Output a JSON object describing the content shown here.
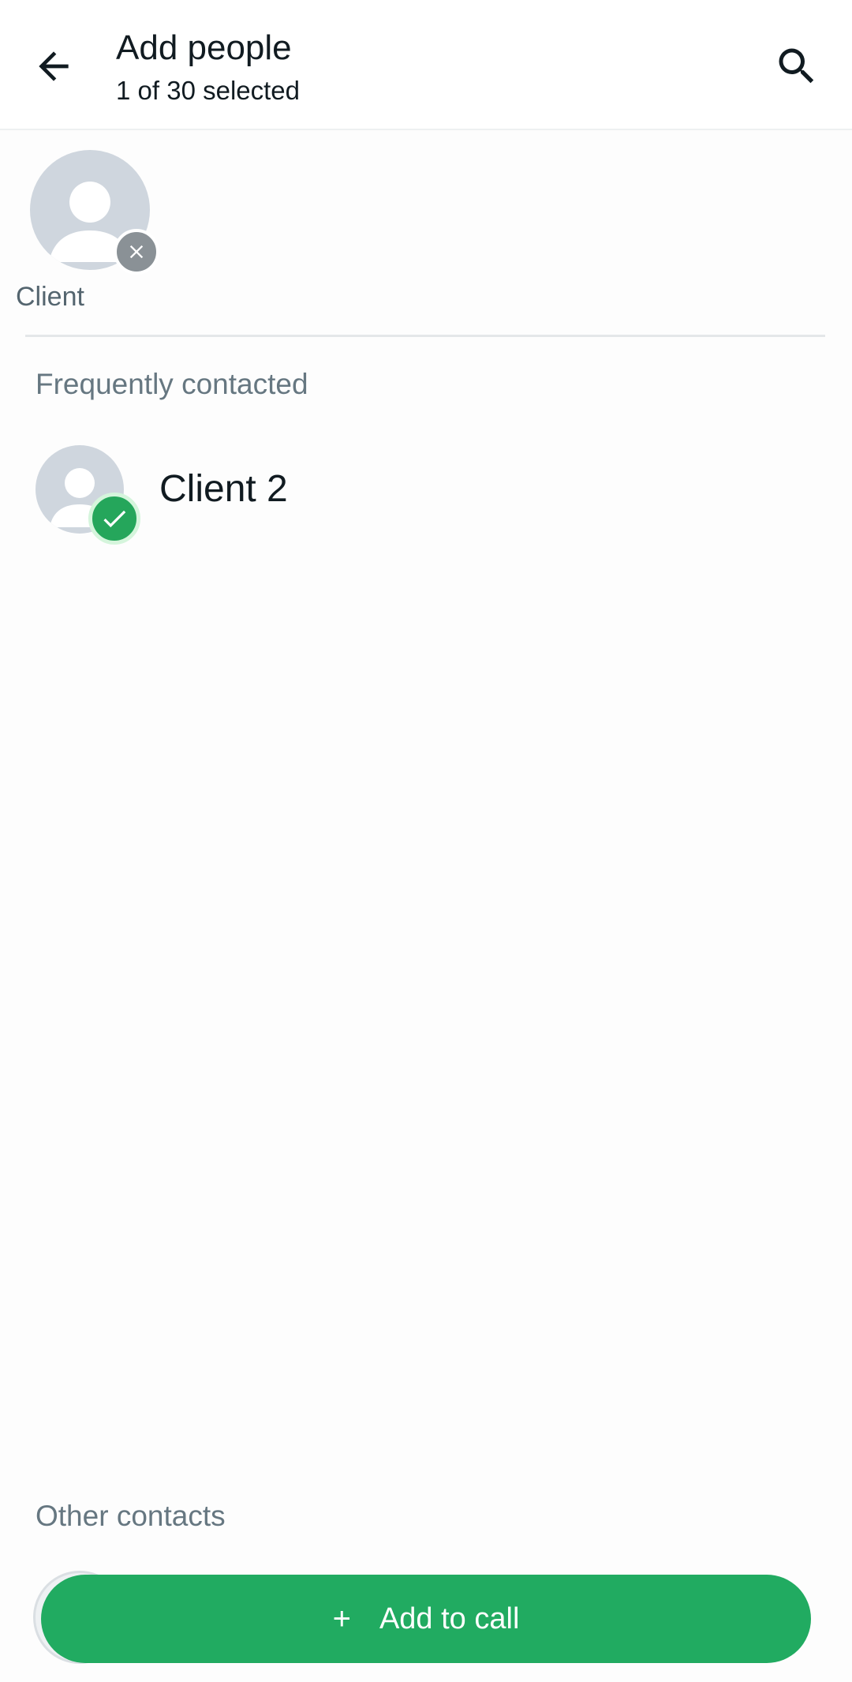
{
  "header": {
    "title": "Add people",
    "subtitle": "1 of 30 selected",
    "back_icon": "arrow-left-icon",
    "search_icon": "search-icon"
  },
  "selected": [
    {
      "name": "Client",
      "remove_icon": "close-icon"
    }
  ],
  "sections": {
    "frequent": "Frequently contacted",
    "other": "Other contacts"
  },
  "frequent_contacts": [
    {
      "name": "Client 2",
      "selected": true,
      "status_icon": "check-icon"
    }
  ],
  "action": {
    "plus": "+",
    "label": "Add to call"
  },
  "colors": {
    "accent": "#21ab61",
    "check": "#25a65b",
    "avatar_bg": "#cfd6de",
    "remove_badge": "#8a9196"
  }
}
